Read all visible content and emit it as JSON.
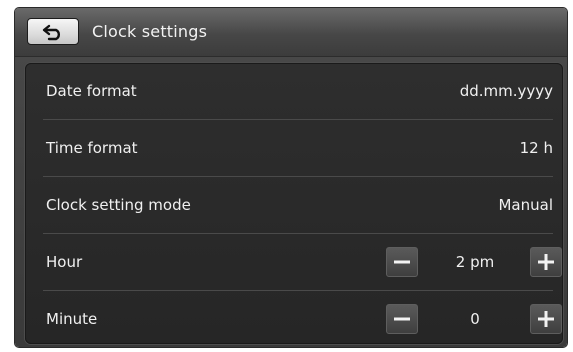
{
  "header": {
    "back_icon": "return-arrow-icon",
    "title": "Clock settings"
  },
  "settings": [
    {
      "label": "Date format",
      "value": "dd.mm.yyyy"
    },
    {
      "label": "Time format",
      "value": "12 h"
    },
    {
      "label": "Clock setting mode",
      "value": "Manual"
    }
  ],
  "steppers": [
    {
      "label": "Hour",
      "value": "2 pm",
      "decrement_icon": "minus-icon",
      "increment_icon": "plus-icon"
    },
    {
      "label": "Minute",
      "value": "0",
      "decrement_icon": "minus-icon",
      "increment_icon": "plus-icon"
    }
  ],
  "colors": {
    "header_bg": "#474747",
    "panel_bg": "#2a2a2a",
    "text": "#f0f0f0",
    "back_button_bg": "#e0e0e0"
  }
}
